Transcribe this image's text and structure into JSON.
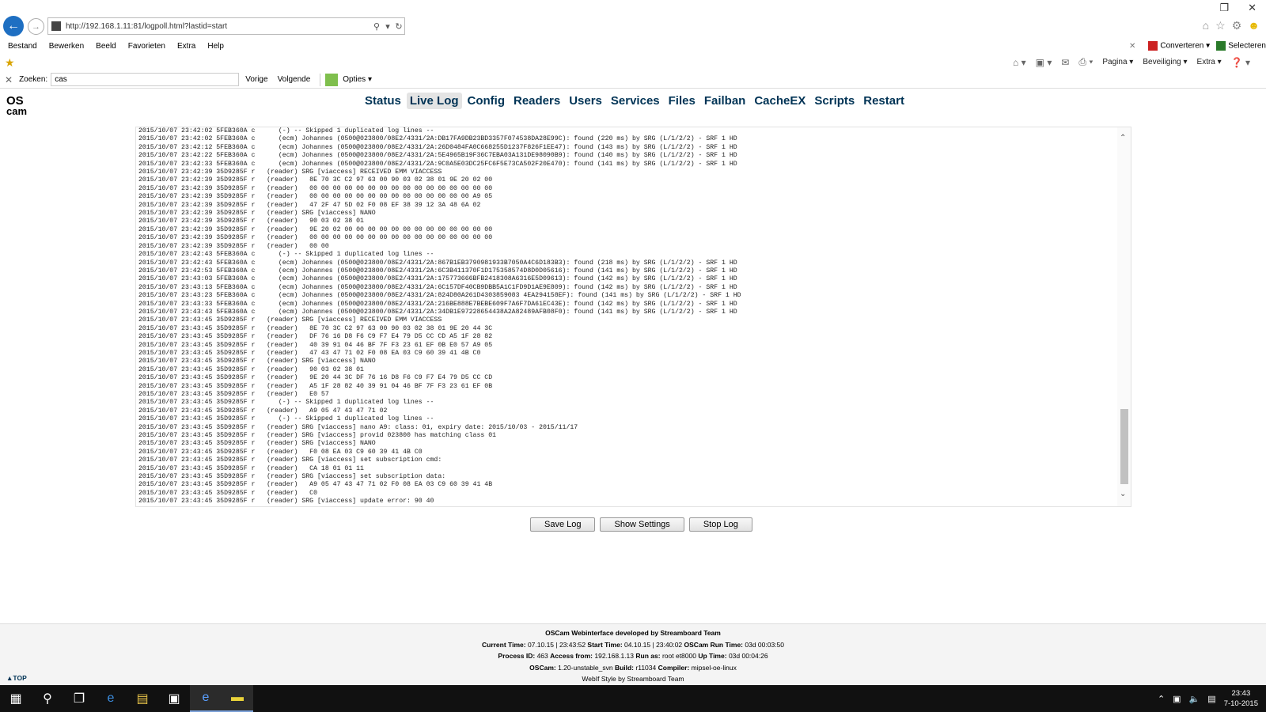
{
  "browser": {
    "url": "http://192.168.1.11:81/logpoll.html?lastid=start",
    "menu": [
      "Bestand",
      "Bewerken",
      "Beeld",
      "Favorieten",
      "Extra",
      "Help"
    ],
    "converteren": "Converteren",
    "selecteren": "Selecteren",
    "cmd": {
      "pagina": "Pagina",
      "beveiliging": "Beveiliging",
      "extra": "Extra"
    },
    "find": {
      "label": "Zoeken:",
      "value": "cas",
      "prev": "Vorige",
      "next": "Volgende",
      "options": "Opties"
    }
  },
  "oscam": {
    "logo_line1": "OS",
    "logo_line2": "cam",
    "menu": [
      "Status",
      "Live Log",
      "Config",
      "Readers",
      "Users",
      "Services",
      "Files",
      "Failban",
      "CacheEX",
      "Scripts",
      "Restart"
    ],
    "active_menu": "Live Log",
    "log_lines": [
      "2015/10/07 23:42:02 5FEB360A c      (-) -- Skipped 1 duplicated log lines --",
      "2015/10/07 23:42:02 5FEB360A c      (ecm) Johannes (0500@023800/08E2/4331/2A:DB17FA9DB23BD3357F074538DA28E99C): found (220 ms) by SRG (L/1/2/2) - SRF 1 HD",
      "2015/10/07 23:42:12 5FEB360A c      (ecm) Johannes (0500@023800/08E2/4331/2A:26D0484FA0C668255D1237F826F1EE47): found (143 ms) by SRG (L/1/2/2) - SRF 1 HD",
      "2015/10/07 23:42:22 5FEB360A c      (ecm) Johannes (0500@023800/08E2/4331/2A:5E4965B19F36C7EBA03A131DE98090B9): found (140 ms) by SRG (L/1/2/2) - SRF 1 HD",
      "2015/10/07 23:42:33 5FEB360A c      (ecm) Johannes (0500@023800/08E2/4331/2A:9C0A5E03DC25FC6F5E73CA502F20E470): found (141 ms) by SRG (L/1/2/2) - SRF 1 HD",
      "2015/10/07 23:42:39 35D9285F r   (reader) SRG [viaccess] RECEIVED EMM VIACCESS",
      "2015/10/07 23:42:39 35D9285F r   (reader)   8E 70 3C C2 97 63 00 90 03 02 38 01 9E 20 02 00",
      "2015/10/07 23:42:39 35D9285F r   (reader)   00 00 00 00 00 00 00 00 00 00 00 00 00 00 00 00",
      "2015/10/07 23:42:39 35D9285F r   (reader)   00 00 00 00 00 00 00 00 00 00 00 00 00 00 A9 05",
      "2015/10/07 23:42:39 35D9285F r   (reader)   47 2F 47 5D 02 F0 08 EF 38 39 12 3A 48 6A 02",
      "2015/10/07 23:42:39 35D9285F r   (reader) SRG [viaccess] NANO",
      "2015/10/07 23:42:39 35D9285F r   (reader)   90 03 02 38 01",
      "2015/10/07 23:42:39 35D9285F r   (reader)   9E 20 02 00 00 00 00 00 00 00 00 00 00 00 00 00",
      "2015/10/07 23:42:39 35D9285F r   (reader)   00 00 00 00 00 00 00 00 00 00 00 00 00 00 00 00",
      "2015/10/07 23:42:39 35D9285F r   (reader)   00 00",
      "2015/10/07 23:42:43 5FEB360A c      (-) -- Skipped 1 duplicated log lines --",
      "2015/10/07 23:42:43 5FEB360A c      (ecm) Johannes (0500@023800/08E2/4331/2A:867B1EB3790981933B7050A4C6D183B3): found (218 ms) by SRG (L/1/2/2) - SRF 1 HD",
      "2015/10/07 23:42:53 5FEB360A c      (ecm) Johannes (0500@023800/08E2/4331/2A:6C3B411370F1D175358574D8D0D05616): found (141 ms) by SRG (L/1/2/2) - SRF 1 HD",
      "2015/10/07 23:43:03 5FEB360A c      (ecm) Johannes (0500@023800/08E2/4331/2A:175773666BFB2418308A6316E5D09613): found (142 ms) by SRG (L/1/2/2) - SRF 1 HD",
      "2015/10/07 23:43:13 5FEB360A c      (ecm) Johannes (0500@023800/08E2/4331/2A:6C157DF40CB9DBB5A1C1FD9D1AE9E809): found (142 ms) by SRG (L/1/2/2) - SRF 1 HD",
      "2015/10/07 23:43:23 5FEB360A c      (ecm) Johannes (0500@023800/08E2/4331/2A:824D80A261D4303859083 4EA294158EF): found (141 ms) by SRG (L/1/2/2) - SRF 1 HD",
      "2015/10/07 23:43:33 5FEB360A c      (ecm) Johannes (0500@023800/08E2/4331/2A:216BE888E7BEBE609F7A6F7DA61EC43E): found (142 ms) by SRG (L/1/2/2) - SRF 1 HD",
      "2015/10/07 23:43:43 5FEB360A c      (ecm) Johannes (0500@023800/08E2/4331/2A:34DB1E97228654438A2A82489AFB08F0): found (141 ms) by SRG (L/1/2/2) - SRF 1 HD",
      "2015/10/07 23:43:45 35D9285F r   (reader) SRG [viaccess] RECEIVED EMM VIACCESS",
      "2015/10/07 23:43:45 35D9285F r   (reader)   8E 70 3C C2 97 63 00 90 03 02 38 01 9E 20 44 3C",
      "2015/10/07 23:43:45 35D9285F r   (reader)   DF 76 16 D8 F6 C9 F7 E4 79 D5 CC CD A5 1F 28 82",
      "2015/10/07 23:43:45 35D9285F r   (reader)   40 39 91 04 46 BF 7F F3 23 61 EF 0B E0 57 A9 05",
      "2015/10/07 23:43:45 35D9285F r   (reader)   47 43 47 71 02 F0 08 EA 03 C9 60 39 41 4B C0",
      "2015/10/07 23:43:45 35D9285F r   (reader) SRG [viaccess] NANO",
      "2015/10/07 23:43:45 35D9285F r   (reader)   90 03 02 38 01",
      "2015/10/07 23:43:45 35D9285F r   (reader)   9E 20 44 3C DF 76 16 D8 F6 C9 F7 E4 79 D5 CC CD",
      "2015/10/07 23:43:45 35D9285F r   (reader)   A5 1F 28 82 40 39 91 04 46 BF 7F F3 23 61 EF 0B",
      "2015/10/07 23:43:45 35D9285F r   (reader)   E0 57",
      "2015/10/07 23:43:45 35D9285F r      (-) -- Skipped 1 duplicated log lines --",
      "2015/10/07 23:43:45 35D9285F r   (reader)   A9 05 47 43 47 71 02",
      "2015/10/07 23:43:45 35D9285F r      (-) -- Skipped 1 duplicated log lines --",
      "2015/10/07 23:43:45 35D9285F r   (reader) SRG [viaccess] nano A9: class: 01, expiry date: 2015/10/03 - 2015/11/17",
      "2015/10/07 23:43:45 35D9285F r   (reader) SRG [viaccess] provid 023800 has matching class 01",
      "2015/10/07 23:43:45 35D9285F r   (reader) SRG [viaccess] NANO",
      "2015/10/07 23:43:45 35D9285F r   (reader)   F0 08 EA 03 C9 60 39 41 4B C0",
      "2015/10/07 23:43:45 35D9285F r   (reader) SRG [viaccess] set subscription cmd:",
      "2015/10/07 23:43:45 35D9285F r   (reader)   CA 18 01 01 11",
      "2015/10/07 23:43:45 35D9285F r   (reader) SRG [viaccess] set subscription data:",
      "2015/10/07 23:43:45 35D9285F r   (reader)   A9 05 47 43 47 71 02 F0 08 EA 03 C9 60 39 41 4B",
      "2015/10/07 23:43:45 35D9285F r   (reader)   C0",
      "2015/10/07 23:43:45 35D9285F r   (reader) SRG [viaccess] update error: 90 40"
    ],
    "buttons": {
      "save": "Save Log",
      "settings": "Show Settings",
      "stop": "Stop Log"
    },
    "footer": {
      "dev": "OSCam Webinterface developed by Streamboard Team",
      "current_time_label": "Current Time:",
      "current_time": "07.10.15 | 23:43:52",
      "start_time_label": "Start Time:",
      "start_time": "04.10.15 | 23:40:02",
      "run_time_label": "OSCam Run Time:",
      "run_time": "03d 00:03:50",
      "process_id_label": "Process ID:",
      "process_id": "463",
      "access_from_label": "Access from:",
      "access_from": "192.168.1.13",
      "run_as_label": "Run as:",
      "run_as": "root",
      "hostname": "et8000",
      "uptime_label": "Up Time:",
      "uptime": "03d 00:04:26",
      "oscam_label": "OSCam:",
      "oscam_version": "1.20-unstable_svn",
      "build_label": "Build:",
      "build": "r11034",
      "compiler_label": "Compiler:",
      "compiler": "mipsel-oe-linux",
      "style": "WebIf Style by Streamboard Team"
    },
    "top_link": "▲TOP"
  },
  "taskbar": {
    "time": "23:43",
    "date": "7-10-2015"
  }
}
